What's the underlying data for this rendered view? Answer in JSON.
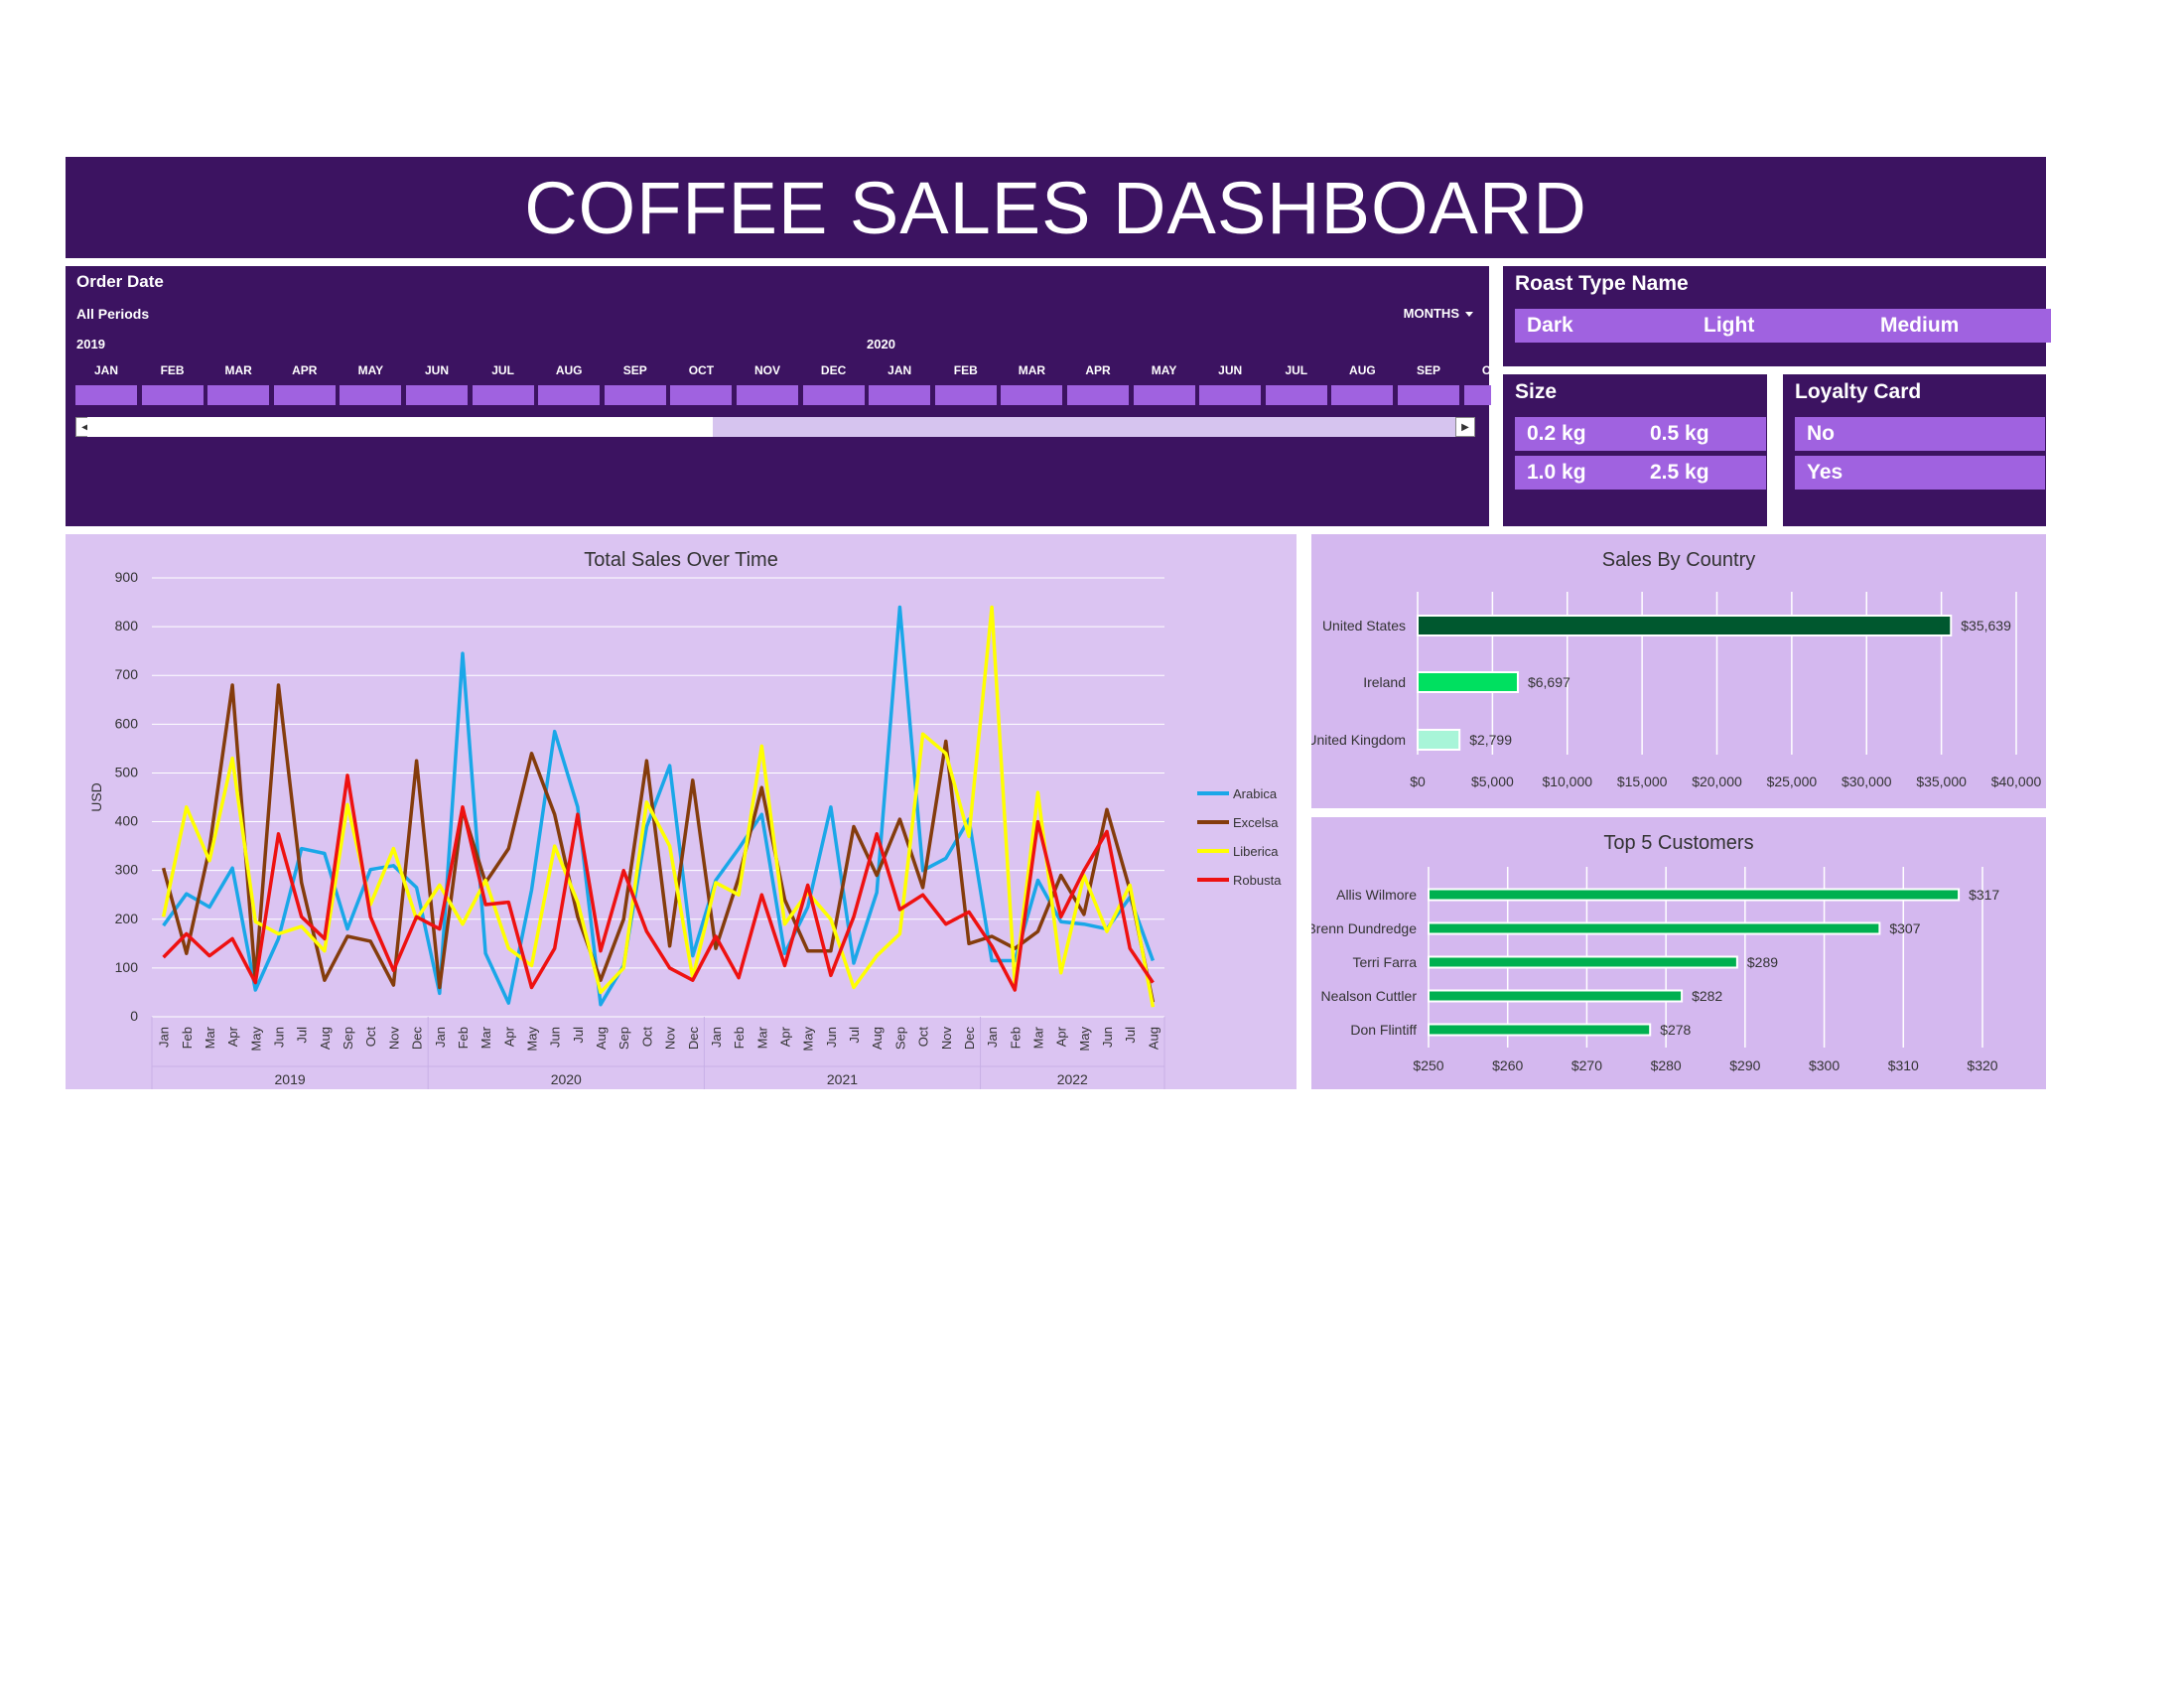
{
  "title": "COFFEE SALES DASHBOARD",
  "timeline": {
    "header": "Order Date",
    "period": "All Periods",
    "level": "MONTHS",
    "years": [
      "2019",
      "2020"
    ],
    "months": [
      "JAN",
      "FEB",
      "MAR",
      "APR",
      "MAY",
      "JUN",
      "JUL",
      "AUG",
      "SEP",
      "OCT",
      "NOV",
      "DEC",
      "JAN",
      "FEB",
      "MAR",
      "APR",
      "MAY",
      "JUN",
      "JUL",
      "AUG",
      "SEP",
      "OCT"
    ]
  },
  "slicers": {
    "roast": {
      "title": "Roast Type Name",
      "items": [
        "Dark",
        "Light",
        "Medium"
      ]
    },
    "size": {
      "title": "Size",
      "items": [
        "0.2 kg",
        "0.5 kg",
        "1.0 kg",
        "2.5 kg"
      ]
    },
    "loyalty": {
      "title": "Loyalty Card",
      "items": [
        "No",
        "Yes"
      ]
    }
  },
  "colors": {
    "header_bg": "#3c1361",
    "slicer_item": "#a062e0",
    "panel_left": "#dbc4f2",
    "panel_right": "#d4b8ef",
    "arabica": "#1aa7e8",
    "excelsa": "#843c0c",
    "liberica": "#ffff00",
    "robusta": "#ee1111"
  },
  "chart_data": [
    {
      "type": "line",
      "title": "Total Sales Over Time",
      "ylabel": "USD",
      "xlabel": "",
      "ylim": [
        0,
        900
      ],
      "yticks": [
        "0",
        "100",
        "200",
        "300",
        "400",
        "500",
        "600",
        "700",
        "800",
        "900"
      ],
      "grid": true,
      "legend_position": "right",
      "month_labels": [
        "Jan",
        "Feb",
        "Mar",
        "Apr",
        "May",
        "Jun",
        "Jul",
        "Aug",
        "Sep",
        "Oct",
        "Nov",
        "Dec"
      ],
      "years": [
        "2019",
        "2020",
        "2021",
        "2022"
      ],
      "months_per_year": [
        12,
        12,
        12,
        8
      ],
      "series": [
        {
          "name": "Arabica",
          "color": "#1aa7e8",
          "values": [
            187,
            252,
            225,
            305,
            55,
            160,
            345,
            335,
            180,
            302,
            310,
            265,
            48,
            745,
            130,
            28,
            260,
            585,
            430,
            25,
            105,
            390,
            515,
            125,
            280,
            345,
            415,
            130,
            225,
            430,
            110,
            255,
            840,
            300,
            325,
            405,
            115,
            115,
            280,
            195,
            190,
            180,
            245,
            115
          ]
        },
        {
          "name": "Excelsa",
          "color": "#843c0c",
          "values": [
            305,
            130,
            345,
            680,
            75,
            680,
            275,
            75,
            165,
            155,
            65,
            525,
            60,
            425,
            275,
            345,
            540,
            415,
            205,
            75,
            200,
            525,
            145,
            485,
            140,
            285,
            470,
            240,
            135,
            135,
            390,
            290,
            405,
            265,
            565,
            150,
            165,
            140,
            175,
            290,
            210,
            425,
            260,
            30
          ]
        },
        {
          "name": "Liberica",
          "color": "#ffff00",
          "values": [
            205,
            430,
            320,
            530,
            195,
            170,
            185,
            135,
            435,
            230,
            345,
            200,
            270,
            190,
            280,
            140,
            105,
            350,
            235,
            50,
            100,
            440,
            350,
            80,
            275,
            250,
            555,
            190,
            255,
            200,
            60,
            125,
            170,
            580,
            540,
            370,
            840,
            65,
            460,
            90,
            290,
            175,
            270,
            20
          ]
        },
        {
          "name": "Robusta",
          "color": "#ee1111",
          "values": [
            122,
            170,
            125,
            160,
            70,
            375,
            205,
            160,
            495,
            205,
            95,
            205,
            180,
            430,
            230,
            235,
            60,
            140,
            415,
            135,
            300,
            175,
            100,
            75,
            165,
            80,
            250,
            105,
            270,
            85,
            205,
            375,
            220,
            250,
            190,
            215,
            145,
            55,
            400,
            205,
            300,
            380,
            140,
            70
          ]
        }
      ]
    },
    {
      "type": "bar",
      "orientation": "horizontal",
      "title": "Sales By Country",
      "categories": [
        "United States",
        "Ireland",
        "United Kingdom"
      ],
      "values": [
        35639,
        6697,
        2799
      ],
      "value_labels": [
        "$35,639",
        "$6,697",
        "$2,799"
      ],
      "colors": [
        "#00582f",
        "#00e060",
        "#a8f5d8"
      ],
      "xlim": [
        0,
        40000
      ],
      "xticks": [
        "$0",
        "$5,000",
        "$10,000",
        "$15,000",
        "$20,000",
        "$25,000",
        "$30,000",
        "$35,000",
        "$40,000"
      ],
      "grid": true
    },
    {
      "type": "bar",
      "orientation": "horizontal",
      "title": "Top 5 Customers",
      "categories": [
        "Allis Wilmore",
        "Brenn Dundredge",
        "Terri Farra",
        "Nealson Cuttler",
        "Don Flintiff"
      ],
      "values": [
        317,
        307,
        289,
        282,
        278
      ],
      "value_labels": [
        "$317",
        "$307",
        "$289",
        "$282",
        "$278"
      ],
      "color": "#00b050",
      "xlim": [
        250,
        320
      ],
      "xticks": [
        "$250",
        "$260",
        "$270",
        "$280",
        "$290",
        "$300",
        "$310",
        "$320"
      ],
      "grid": true
    }
  ]
}
